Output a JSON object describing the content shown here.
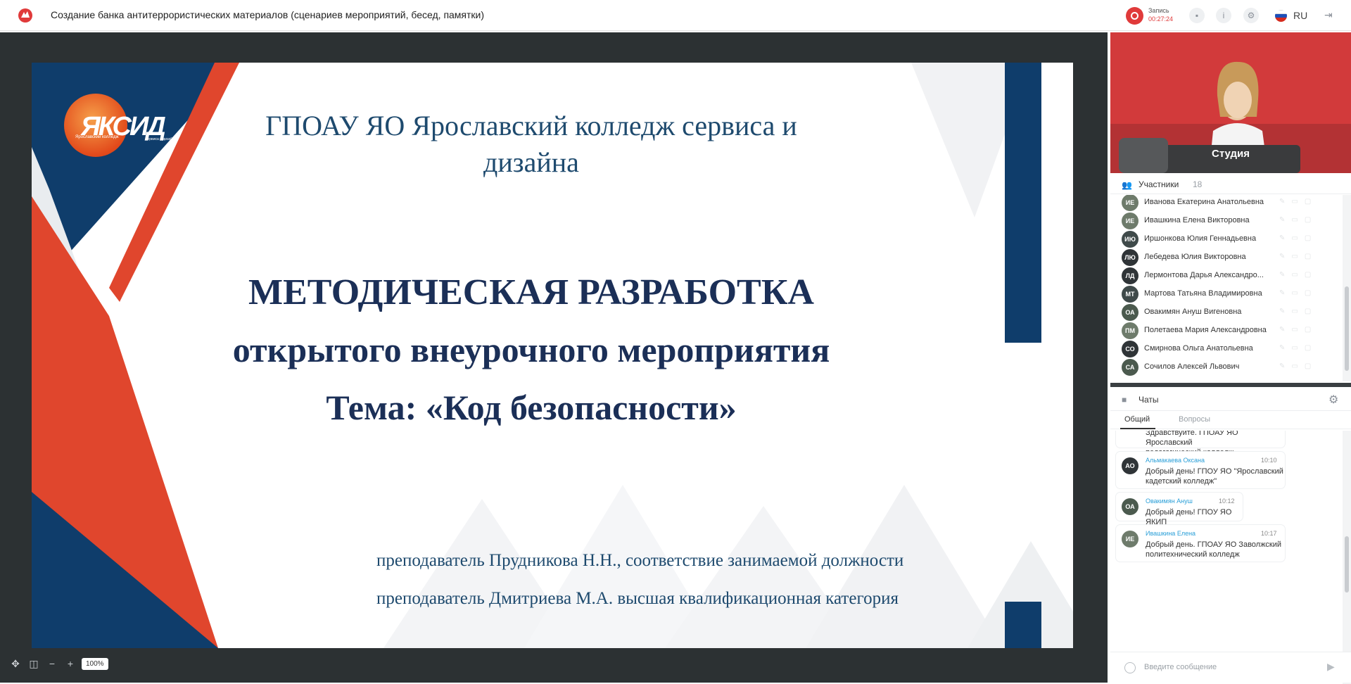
{
  "topbar": {
    "title": "Создание банка антитеррористических материалов (сценариев мероприятий, бесед, памятки)",
    "record_label": "Запись",
    "record_time": "00:27:24",
    "language": "RU"
  },
  "slide": {
    "logo_text": "ЯКСИД",
    "logo_sub1": "Ярославский колледж",
    "logo_sub2": "сервиса и дизайна",
    "org_line1": "ГПОАУ ЯО Ярославский колледж сервиса и",
    "org_line2": "дизайна",
    "main_line1": "МЕТОДИЧЕСКАЯ РАЗРАБОТКА",
    "main_line2": "открытого внеурочного мероприятия",
    "main_line3": "Тема: «Код безопасности»",
    "author1": "преподаватель Прудникова Н.Н., соответствие занимаемой должности",
    "author2": "преподаватель Дмитриева М.А. высшая квалификационная категория",
    "colors": {
      "navy": "#0f3d6b",
      "red": "#e0462d",
      "title": "#1b2f57"
    }
  },
  "stage_tools": {
    "zoom": "100%"
  },
  "video": {
    "name": "Студия"
  },
  "participants": {
    "title": "Участники",
    "count": "18",
    "items": [
      {
        "initials": "ИЕ",
        "name": "Иванова Екатерина Анатольевна",
        "color": "#6e7b6b"
      },
      {
        "initials": "ИЕ",
        "name": "Ивашкина Елена Викторовна",
        "color": "#6e7b6b"
      },
      {
        "initials": "ИЮ",
        "name": "Иршонкова Юлия Геннадьевна",
        "color": "#3f4a4a"
      },
      {
        "initials": "ЛЮ",
        "name": "Лебедева Юлия Викторовна",
        "color": "#2f3437"
      },
      {
        "initials": "ЛД",
        "name": "Лермонтова Дарья Александро...",
        "color": "#2f3437"
      },
      {
        "initials": "МТ",
        "name": "Мартова Татьяна Владимировна",
        "color": "#3f4a4a"
      },
      {
        "initials": "ОА",
        "name": "Овакимян Ануш Вигеновна",
        "color": "#4b5a4e"
      },
      {
        "initials": "ПМ",
        "name": "Полетаева Мария Александровна",
        "color": "#6e7b6b"
      },
      {
        "initials": "СО",
        "name": "Смирнова Ольга Анатольевна",
        "color": "#2f3437"
      },
      {
        "initials": "СА",
        "name": "Сочилов Алексей Львович",
        "color": "#4b5a4e"
      }
    ]
  },
  "chats": {
    "title": "Чаты",
    "tab_general": "Общий",
    "tab_questions": "Вопросы",
    "messages": [
      {
        "initials": "",
        "author": "",
        "time": "",
        "text_line1": "Здравствуйте. ГПОАУ ЯО Ярославский",
        "text_line2": "педагогический колледж"
      },
      {
        "initials": "АО",
        "author": "Альмакаева Оксана",
        "time": "10:10",
        "text_line1": "Добрый день! ГПОУ ЯО \"Ярославский",
        "text_line2": "кадетский колледж\"",
        "color": "#2f3437"
      },
      {
        "initials": "ОА",
        "author": "Овакимян Ануш",
        "time": "10:12",
        "text_line1": "Добрый день! ГПОУ ЯО ЯКИП",
        "text_line2": "",
        "color": "#4b5a4e"
      },
      {
        "initials": "ИЕ",
        "author": "Ивашкина Елена",
        "time": "10:17",
        "text_line1": "Добрый день. ГПОАУ ЯО Заволжский",
        "text_line2": "политехнический колледж",
        "color": "#6e7b6b"
      }
    ],
    "input_placeholder": "Введите сообщение"
  }
}
